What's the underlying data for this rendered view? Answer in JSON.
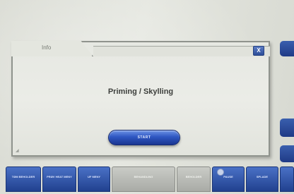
{
  "dialog": {
    "title": "Info",
    "close_label": "X",
    "message": "Priming / Skylling",
    "start_label": "START"
  },
  "toolbar": {
    "buttons": [
      {
        "label": "TØM BEHOLDER"
      },
      {
        "label": "PRØV HEAT MENY"
      },
      {
        "label": "UF MENY"
      },
      {
        "label": "BEHANDLING"
      },
      {
        "label": "BEHOLDER"
      },
      {
        "label": "PAUSE"
      },
      {
        "label": "SPLADE"
      },
      {
        "label": ""
      }
    ]
  },
  "right_edge": {
    "buttons": [
      {
        "label": ""
      },
      {
        "label": ""
      },
      {
        "label": ""
      }
    ]
  },
  "colors": {
    "accent": "#2f57c2",
    "screen": "#e4e6df",
    "disabled": "#b9bbb6"
  }
}
